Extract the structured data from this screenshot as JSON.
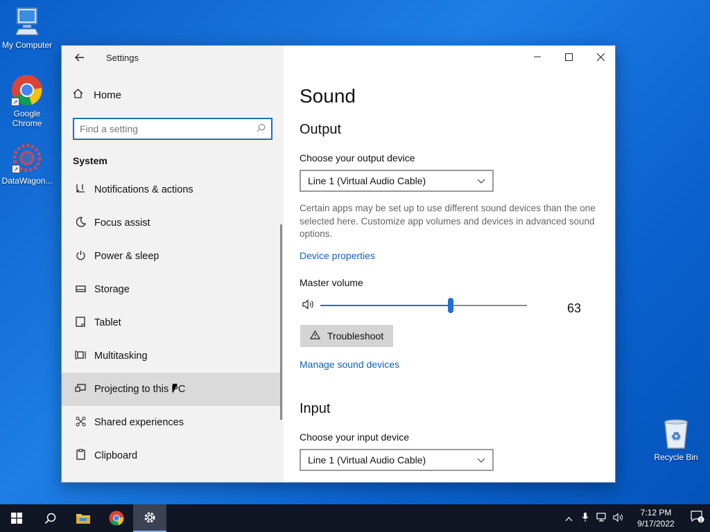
{
  "desktop": {
    "icons": [
      {
        "label": "My Computer",
        "icon": "computer-icon"
      },
      {
        "label": "Google Chrome",
        "icon": "chrome-icon"
      },
      {
        "label": "DataWagon...",
        "icon": "datawagon-icon"
      },
      {
        "label": "Recycle Bin",
        "icon": "recycle-bin-icon"
      }
    ]
  },
  "window": {
    "title": "Settings",
    "nav": {
      "home_label": "Home",
      "search_placeholder": "Find a setting",
      "section": "System",
      "items": [
        {
          "label": "Notifications & actions",
          "icon": "notifications-icon"
        },
        {
          "label": "Focus assist",
          "icon": "moon-icon"
        },
        {
          "label": "Power & sleep",
          "icon": "power-icon"
        },
        {
          "label": "Storage",
          "icon": "storage-icon"
        },
        {
          "label": "Tablet",
          "icon": "tablet-icon"
        },
        {
          "label": "Multitasking",
          "icon": "multitasking-icon"
        },
        {
          "label": "Projecting to this PC",
          "icon": "projecting-icon",
          "active": true
        },
        {
          "label": "Shared experiences",
          "icon": "shared-icon"
        },
        {
          "label": "Clipboard",
          "icon": "clipboard-icon"
        }
      ]
    },
    "content": {
      "page_title": "Sound",
      "output": {
        "heading": "Output",
        "choose_label": "Choose your output device",
        "device": "Line 1 (Virtual Audio Cable)",
        "description": "Certain apps may be set up to use different sound devices than the one selected here. Customize app volumes and devices in advanced sound options.",
        "device_properties_link": "Device properties",
        "master_volume_label": "Master volume",
        "volume": 63,
        "troubleshoot_label": "Troubleshoot",
        "manage_link": "Manage sound devices"
      },
      "input": {
        "heading": "Input",
        "choose_label": "Choose your input device",
        "device": "Line 1 (Virtual Audio Cable)"
      }
    }
  },
  "taskbar": {
    "time": "7:12 PM",
    "date": "9/17/2022",
    "notification_count": "1"
  },
  "colors": {
    "accent": "#1e6fd0",
    "link": "#1062b8",
    "nav_bg": "#f2f2f2",
    "taskbar_bg": "#101624"
  }
}
